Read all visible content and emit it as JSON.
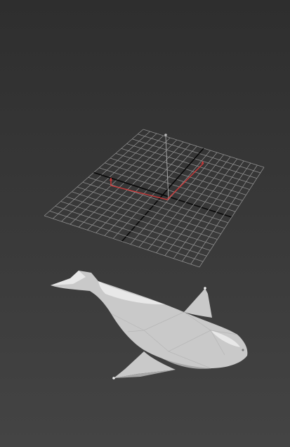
{
  "viewport": {
    "background_top": "#2e2e2e",
    "background_bottom": "#444444"
  },
  "grid": {
    "line_color": "#8e8e8e",
    "axis_color": "#080808",
    "divisions": 18
  },
  "gizmo": {
    "color": "#d03a3a",
    "pivot_line_color": "#a6a6a6"
  },
  "model": {
    "name": "whale",
    "fill_color": "#c9c9c9",
    "shade_color": "#a6a6a6",
    "highlight_color": "#e8e8e8"
  }
}
